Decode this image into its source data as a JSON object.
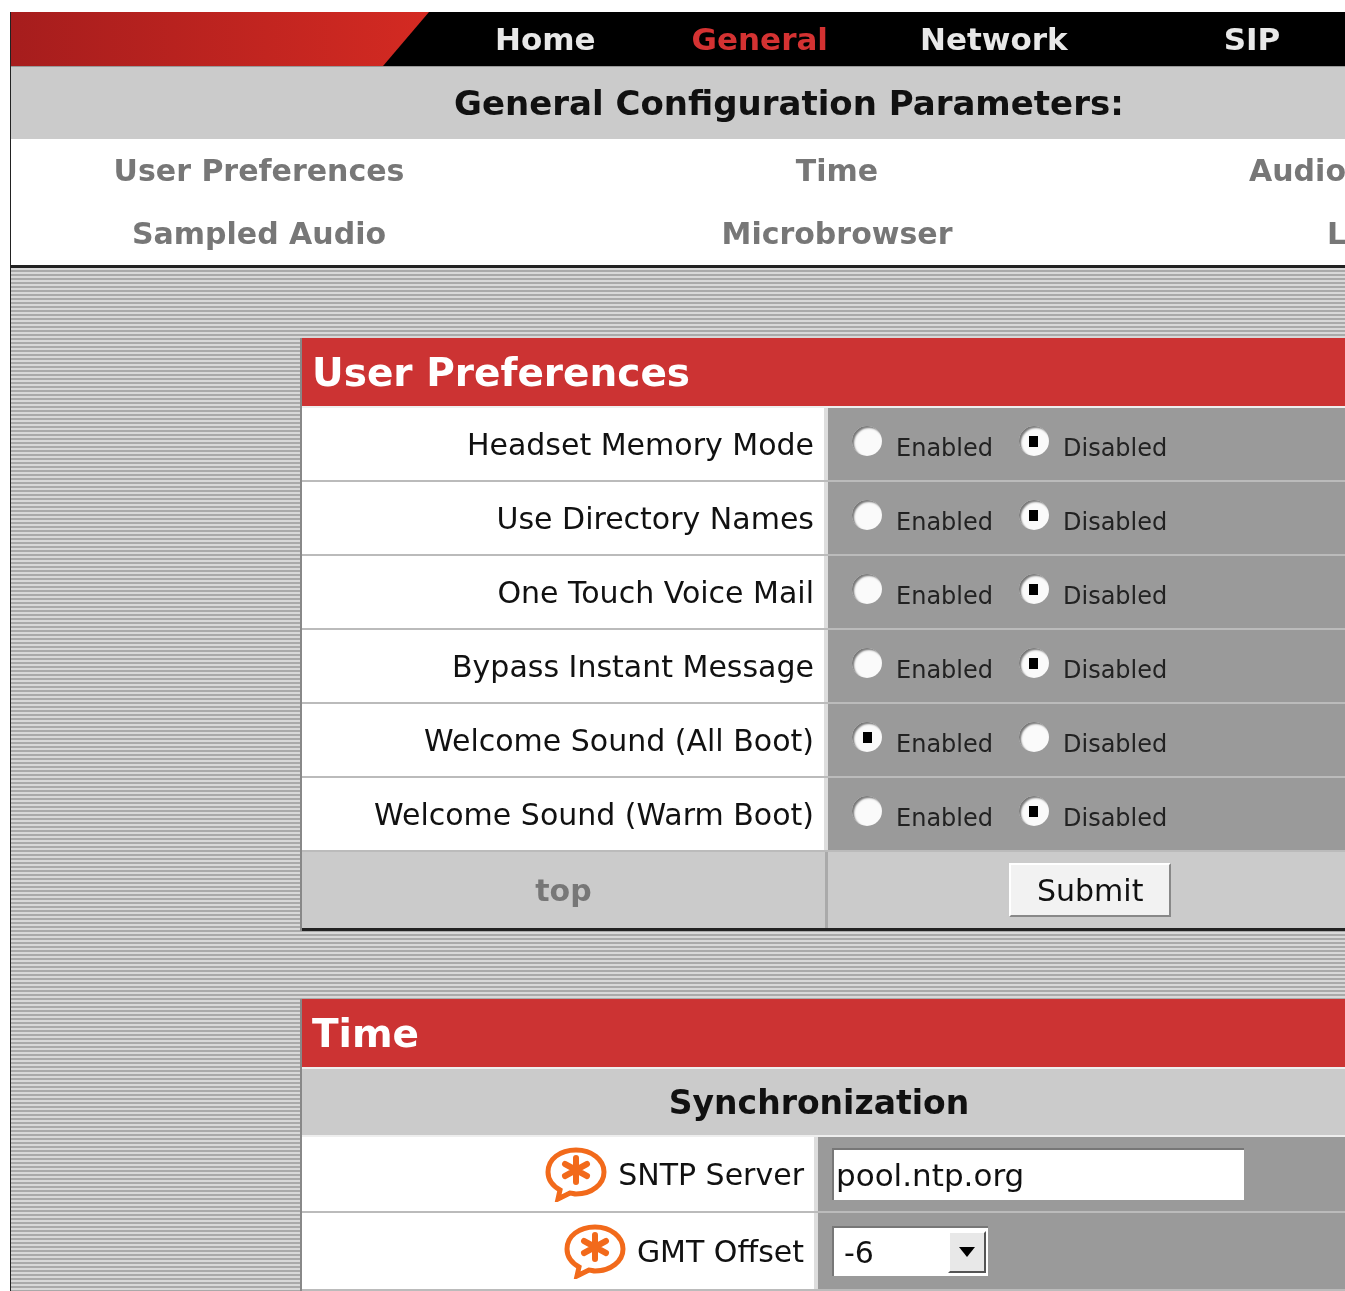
{
  "nav": {
    "items": [
      {
        "label": "Home",
        "selected": false
      },
      {
        "label": "General",
        "selected": true
      },
      {
        "label": "Network",
        "selected": false
      },
      {
        "label": "SIP",
        "selected": false
      }
    ]
  },
  "page_title": "General Configuration Parameters:",
  "section_links": [
    {
      "label": "User Preferences"
    },
    {
      "label": "Time"
    },
    {
      "label": "Audio"
    },
    {
      "label": "Sampled Audio"
    },
    {
      "label": "Microbrowser"
    },
    {
      "label": "L"
    }
  ],
  "user_preferences": {
    "title": "User Preferences",
    "rows": [
      {
        "label": "Headset Memory Mode",
        "options": [
          {
            "label": "Enabled",
            "selected": false
          },
          {
            "label": "Disabled",
            "selected": true
          }
        ]
      },
      {
        "label": "Use Directory Names",
        "options": [
          {
            "label": "Enabled",
            "selected": false
          },
          {
            "label": "Disabled",
            "selected": true
          }
        ]
      },
      {
        "label": "One Touch Voice Mail",
        "options": [
          {
            "label": "Enabled",
            "selected": false
          },
          {
            "label": "Disabled",
            "selected": true
          }
        ]
      },
      {
        "label": "Bypass Instant Message",
        "options": [
          {
            "label": "Enabled",
            "selected": false
          },
          {
            "label": "Disabled",
            "selected": true
          }
        ]
      },
      {
        "label": "Welcome Sound (All Boot)",
        "options": [
          {
            "label": "Enabled",
            "selected": true
          },
          {
            "label": "Disabled",
            "selected": false
          }
        ]
      },
      {
        "label": "Welcome Sound (Warm Boot)",
        "options": [
          {
            "label": "Enabled",
            "selected": false
          },
          {
            "label": "Disabled",
            "selected": true
          }
        ]
      }
    ],
    "top_link": "top",
    "submit": "Submit"
  },
  "time": {
    "title": "Time",
    "subheading": "Synchronization",
    "fields": [
      {
        "kind": "text",
        "label": "SNTP Server",
        "required": true,
        "value": "pool.ntp.org"
      },
      {
        "kind": "select",
        "label": "GMT Offset",
        "required": true,
        "value": "-6"
      }
    ]
  }
}
